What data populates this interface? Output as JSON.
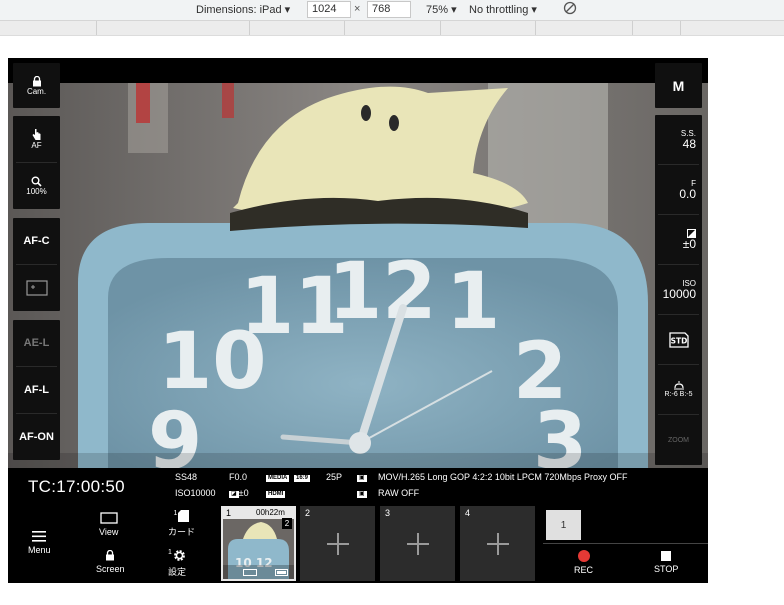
{
  "devtools": {
    "dimensions_label": "Dimensions: iPad",
    "width": "1024",
    "times": "×",
    "height": "768",
    "zoom": "75%",
    "throttle": "No throttling"
  },
  "left_panel": {
    "cam_label": "Cam.",
    "af_label": "AF",
    "zoom_label": "100%",
    "afc_label": "AF-C",
    "ael_label": "AE-L",
    "afl_label": "AF-L",
    "afon_label": "AF-ON"
  },
  "right_panel": {
    "mode": "M",
    "ss_label": "S.S.",
    "ss_value": "48",
    "f_label": "F",
    "f_value": "0.0",
    "ev_value": "±0",
    "iso_label": "ISO",
    "iso_value": "10000",
    "wb_value": "R:-6 B:-5",
    "zoom_label": "ZOOM"
  },
  "info_bar": {
    "timecode": "TC:17:00:50",
    "ss": "SS48",
    "f": "F0.0",
    "fps": "25P",
    "format": "MOV/H.265 Long GOP 4:2:2 10bit LPCM 720Mbps Proxy OFF",
    "iso": "ISO10000",
    "ev": "±0",
    "raw": "RAW OFF",
    "media_badge": "MEDIA",
    "hdmi_badge": "HDMI",
    "ratio_badge": "16:9"
  },
  "controls": {
    "menu_label": "Menu",
    "view_label": "View",
    "screen_label": "Screen",
    "card_label": "カード",
    "settings_label": "設定",
    "card_num": "1",
    "settings_num": "1",
    "clips": [
      {
        "num": "1",
        "duration": "00h22m",
        "badge": "2"
      },
      {
        "num": "2"
      },
      {
        "num": "3"
      },
      {
        "num": "4"
      }
    ],
    "slot_label": "1",
    "rec_label": "REC",
    "stop_label": "STOP"
  }
}
